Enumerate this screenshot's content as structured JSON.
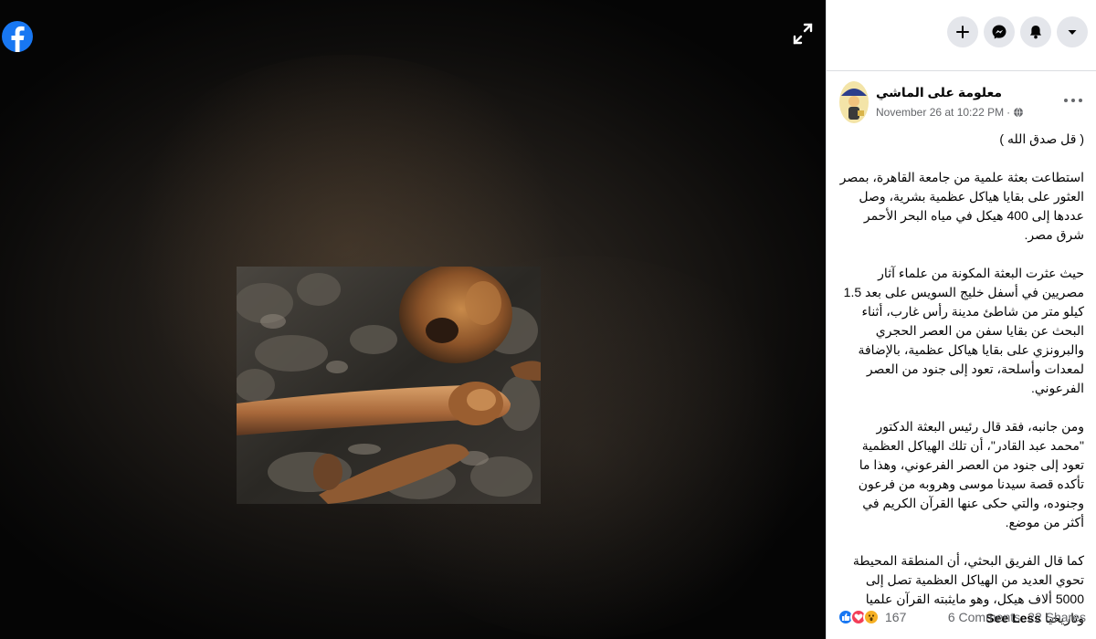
{
  "post": {
    "author": "معلومة على الماشي",
    "timestamp": "November 26 at 10:22 PM",
    "dot": "·",
    "paragraphs": [
      "( قل صدق الله )",
      "استطاعت بعثة علمية من جامعة القاهرة، بمصر العثور على بقايا هياكل عظمية بشرية، وصل عددها إلى 400 هيكل في مياه البحر الأحمر شرق مصر.",
      "حيث عثرت البعثة المكونة من علماء آثار مصريين في أسفل خليج السويس على بعد 1.5 كيلو متر من شاطئ مدينة رأس غارب، أثناء البحث عن بقايا سفن من العصر الحجري والبرونزي على بقايا هياكل عظمية، بالإضافة لمعدات وأسلحة، تعود إلى جنود من العصر الفرعوني.",
      "ومن جانبه، فقد قال رئيس البعثة الدكتور \"محمد عبد القادر\"، أن تلك الهياكل العظمية تعود إلى جنود من العصر الفرعوني، وهذا ما تأكده قصة سيدنا موسى وهروبه من فرعون وجنوده، والتي حكى عنها القرآن الكريم في أكثر من موضع.",
      "كما قال الفريق البحثي، أن المنطقة المحيطة تحوي العديد من الهياكل العظمية تصل إلى 5000 ألاف هيكل، وهو مايثبته القرآن علميا وتاريخيا"
    ],
    "see_less": "See Less",
    "reaction_count": "167",
    "comments": "6 Comments",
    "shares": "22 Shares"
  },
  "icons": {
    "logo": "facebook-logo",
    "expand": "expand-icon",
    "create": "plus-icon",
    "messenger": "messenger-icon",
    "notifications": "bell-icon",
    "account": "caret-down-icon",
    "privacy": "globe-icon",
    "options": "more-options-icon"
  },
  "colors": {
    "brand": "#1877f2",
    "panel_bg": "#ffffff",
    "muted_text": "#65676b",
    "button_bg": "#e4e6eb"
  }
}
